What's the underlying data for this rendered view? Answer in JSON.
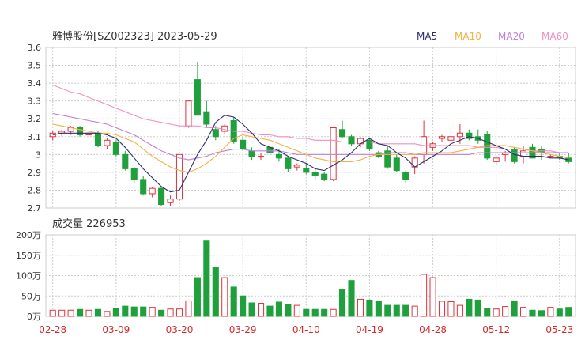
{
  "header": {
    "title": "雅博股份[SZ002323] 2023-05-29",
    "legend": [
      {
        "label": "MA5",
        "color": "#2f2f6f"
      },
      {
        "label": "MA10",
        "color": "#f5b041"
      },
      {
        "label": "MA20",
        "color": "#bf7fd9"
      },
      {
        "label": "MA60",
        "color": "#f08fbf"
      }
    ]
  },
  "volume_header": {
    "label": "成交量 226953"
  },
  "colors": {
    "up": "#e0303a",
    "down": "#1fa03c",
    "grid": "#cccccc",
    "axis_text": "#333333",
    "date_text": "#d12a2a"
  },
  "chart_data": [
    {
      "type": "candlestick",
      "ylim": [
        2.7,
        3.6
      ],
      "yticks": [
        "3.6",
        "3.5",
        "3.4",
        "3.3",
        "3.2",
        "3.1",
        "3",
        "2.9",
        "2.8",
        "2.7"
      ],
      "ytick_values": [
        3.6,
        3.5,
        3.4,
        3.3,
        3.2,
        3.1,
        3.0,
        2.9,
        2.8,
        2.7
      ],
      "x_date_labels": [
        {
          "label": "02-28",
          "index": 0
        },
        {
          "label": "03-09",
          "index": 7
        },
        {
          "label": "03-20",
          "index": 14
        },
        {
          "label": "03-29",
          "index": 21
        },
        {
          "label": "04-10",
          "index": 28
        },
        {
          "label": "04-19",
          "index": 35
        },
        {
          "label": "04-28",
          "index": 42
        },
        {
          "label": "05-12",
          "index": 49
        },
        {
          "label": "05-23",
          "index": 56
        }
      ],
      "ohlc": [
        [
          3.1,
          3.13,
          3.08,
          3.12
        ],
        [
          3.12,
          3.14,
          3.1,
          3.13
        ],
        [
          3.13,
          3.16,
          3.11,
          3.15
        ],
        [
          3.15,
          3.16,
          3.1,
          3.11
        ],
        [
          3.11,
          3.13,
          3.09,
          3.12
        ],
        [
          3.12,
          3.13,
          3.04,
          3.05
        ],
        [
          3.05,
          3.09,
          3.03,
          3.08
        ],
        [
          3.07,
          3.08,
          2.99,
          3.0
        ],
        [
          3.0,
          3.02,
          2.91,
          2.92
        ],
        [
          2.92,
          2.93,
          2.84,
          2.86
        ],
        [
          2.86,
          2.88,
          2.77,
          2.78
        ],
        [
          2.78,
          2.82,
          2.76,
          2.81
        ],
        [
          2.81,
          2.82,
          2.71,
          2.72
        ],
        [
          2.73,
          2.77,
          2.71,
          2.75
        ],
        [
          2.75,
          3.0,
          2.74,
          3.0
        ],
        [
          3.16,
          3.3,
          3.15,
          3.3
        ],
        [
          3.42,
          3.52,
          3.24,
          3.22
        ],
        [
          3.24,
          3.3,
          3.15,
          3.17
        ],
        [
          3.14,
          3.16,
          3.08,
          3.1
        ],
        [
          3.13,
          3.17,
          3.11,
          3.16
        ],
        [
          3.19,
          3.21,
          3.06,
          3.07
        ],
        [
          3.08,
          3.1,
          3.02,
          3.03
        ],
        [
          3.02,
          3.04,
          2.97,
          2.99
        ],
        [
          2.99,
          3.01,
          2.97,
          2.99
        ],
        [
          3.04,
          3.06,
          3.0,
          3.01
        ],
        [
          3.0,
          3.03,
          2.96,
          2.98
        ],
        [
          2.98,
          2.99,
          2.9,
          2.92
        ],
        [
          2.93,
          2.95,
          2.91,
          2.94
        ],
        [
          2.92,
          2.95,
          2.89,
          2.9
        ],
        [
          2.9,
          2.92,
          2.86,
          2.88
        ],
        [
          2.89,
          2.9,
          2.85,
          2.86
        ],
        [
          2.86,
          3.15,
          2.85,
          3.15
        ],
        [
          3.14,
          3.19,
          3.09,
          3.1
        ],
        [
          3.1,
          3.11,
          3.05,
          3.06
        ],
        [
          3.06,
          3.1,
          3.04,
          3.09
        ],
        [
          3.08,
          3.09,
          3.02,
          3.03
        ],
        [
          3.01,
          3.02,
          2.98,
          2.99
        ],
        [
          3.02,
          3.05,
          2.92,
          2.93
        ],
        [
          2.98,
          3.0,
          2.9,
          2.91
        ],
        [
          2.9,
          2.91,
          2.84,
          2.86
        ],
        [
          2.93,
          2.99,
          2.89,
          2.98
        ],
        [
          3.0,
          3.19,
          2.95,
          3.1
        ],
        [
          3.04,
          3.07,
          3.02,
          3.06
        ],
        [
          3.09,
          3.11,
          3.07,
          3.1
        ],
        [
          3.08,
          3.16,
          3.05,
          3.1
        ],
        [
          3.1,
          3.17,
          3.06,
          3.12
        ],
        [
          3.12,
          3.14,
          3.08,
          3.09
        ],
        [
          3.1,
          3.14,
          3.06,
          3.08
        ],
        [
          3.11,
          3.13,
          2.97,
          2.98
        ],
        [
          2.96,
          2.99,
          2.94,
          2.98
        ],
        [
          3.0,
          3.02,
          2.96,
          3.01
        ],
        [
          3.03,
          3.04,
          2.95,
          2.96
        ],
        [
          2.99,
          3.05,
          2.95,
          3.02
        ],
        [
          3.04,
          3.06,
          2.98,
          2.98
        ],
        [
          3.03,
          3.05,
          2.97,
          3.01
        ],
        [
          2.99,
          3.0,
          2.98,
          2.99
        ],
        [
          2.99,
          3.01,
          2.97,
          2.98
        ],
        [
          2.98,
          3.01,
          2.95,
          2.96
        ]
      ],
      "ma5": [
        3.11,
        3.12,
        3.12,
        3.12,
        3.12,
        3.12,
        3.11,
        3.09,
        3.04,
        2.98,
        2.92,
        2.87,
        2.82,
        2.79,
        2.8,
        2.9,
        3.0,
        3.08,
        3.18,
        3.22,
        3.21,
        3.17,
        3.12,
        3.06,
        3.04,
        3.02,
        2.99,
        2.97,
        2.95,
        2.92,
        2.91,
        2.94,
        2.97,
        3.01,
        3.06,
        3.09,
        3.06,
        3.05,
        3.01,
        2.98,
        2.93,
        2.96,
        2.99,
        3.02,
        3.06,
        3.08,
        3.1,
        3.09,
        3.07,
        3.05,
        3.03,
        3.0,
        2.99,
        2.99,
        2.99,
        2.98,
        2.98,
        2.97
      ],
      "ma10": [
        3.17,
        3.16,
        3.15,
        3.14,
        3.13,
        3.12,
        3.12,
        3.11,
        3.09,
        3.07,
        3.03,
        2.99,
        2.96,
        2.93,
        2.91,
        2.9,
        2.92,
        2.95,
        2.99,
        3.04,
        3.09,
        3.11,
        3.1,
        3.09,
        3.08,
        3.06,
        3.04,
        3.02,
        3.0,
        2.98,
        2.97,
        2.96,
        2.96,
        2.96,
        2.97,
        2.99,
        3.0,
        3.0,
        3.0,
        3.0,
        3.0,
        3.01,
        3.01,
        3.01,
        3.01,
        3.02,
        3.03,
        3.04,
        3.05,
        3.05,
        3.05,
        3.04,
        3.03,
        3.02,
        3.01,
        3.0,
        2.99,
        2.98
      ],
      "ma20": [
        3.23,
        3.22,
        3.21,
        3.2,
        3.19,
        3.18,
        3.17,
        3.15,
        3.13,
        3.11,
        3.08,
        3.05,
        3.02,
        3.0,
        2.98,
        2.97,
        2.98,
        2.99,
        3.01,
        3.02,
        3.03,
        3.03,
        3.02,
        3.02,
        3.02,
        3.02,
        3.01,
        3.0,
        3.0,
        3.0,
        3.0,
        3.0,
        3.0,
        3.0,
        3.0,
        3.0,
        3.0,
        3.01,
        3.01,
        3.01,
        3.0,
        3.0,
        3.0,
        3.0,
        3.0,
        3.0,
        3.0,
        3.01,
        3.01,
        3.01,
        3.01,
        3.01,
        3.01,
        3.01,
        3.01,
        3.01,
        3.01,
        3.01
      ],
      "ma60": [
        3.39,
        3.37,
        3.35,
        3.34,
        3.32,
        3.3,
        3.28,
        3.26,
        3.24,
        3.22,
        3.2,
        3.19,
        3.18,
        3.17,
        3.16,
        3.16,
        3.16,
        3.15,
        3.15,
        3.14,
        3.13,
        3.13,
        3.12,
        3.11,
        3.11,
        3.1,
        3.1,
        3.09,
        3.09,
        3.08,
        3.08,
        3.08,
        3.07,
        3.07,
        3.07,
        3.07,
        3.06,
        3.06,
        3.06,
        3.06,
        3.06,
        3.05,
        3.05,
        3.05,
        3.05,
        3.05,
        3.05,
        3.04,
        3.04,
        3.04,
        3.03,
        3.03,
        3.03,
        3.02,
        3.02,
        3.02,
        3.01,
        3.01
      ]
    },
    {
      "type": "bar",
      "title": "成交量 226953",
      "ylim": [
        0,
        200
      ],
      "yticks": [
        "200万",
        "150万",
        "100万",
        "50万",
        "0万"
      ],
      "ytick_values": [
        200,
        150,
        100,
        50,
        0
      ],
      "unit": "万",
      "values": [
        15,
        15,
        15,
        17,
        15,
        17,
        12,
        20,
        25,
        23,
        23,
        22,
        15,
        18,
        18,
        38,
        95,
        185,
        120,
        95,
        72,
        50,
        33,
        32,
        25,
        35,
        30,
        27,
        17,
        17,
        17,
        17,
        65,
        88,
        42,
        40,
        36,
        27,
        27,
        27,
        25,
        103,
        95,
        37,
        36,
        27,
        42,
        40,
        20,
        18,
        24,
        38,
        22,
        15,
        14,
        22,
        18,
        22
      ]
    }
  ]
}
